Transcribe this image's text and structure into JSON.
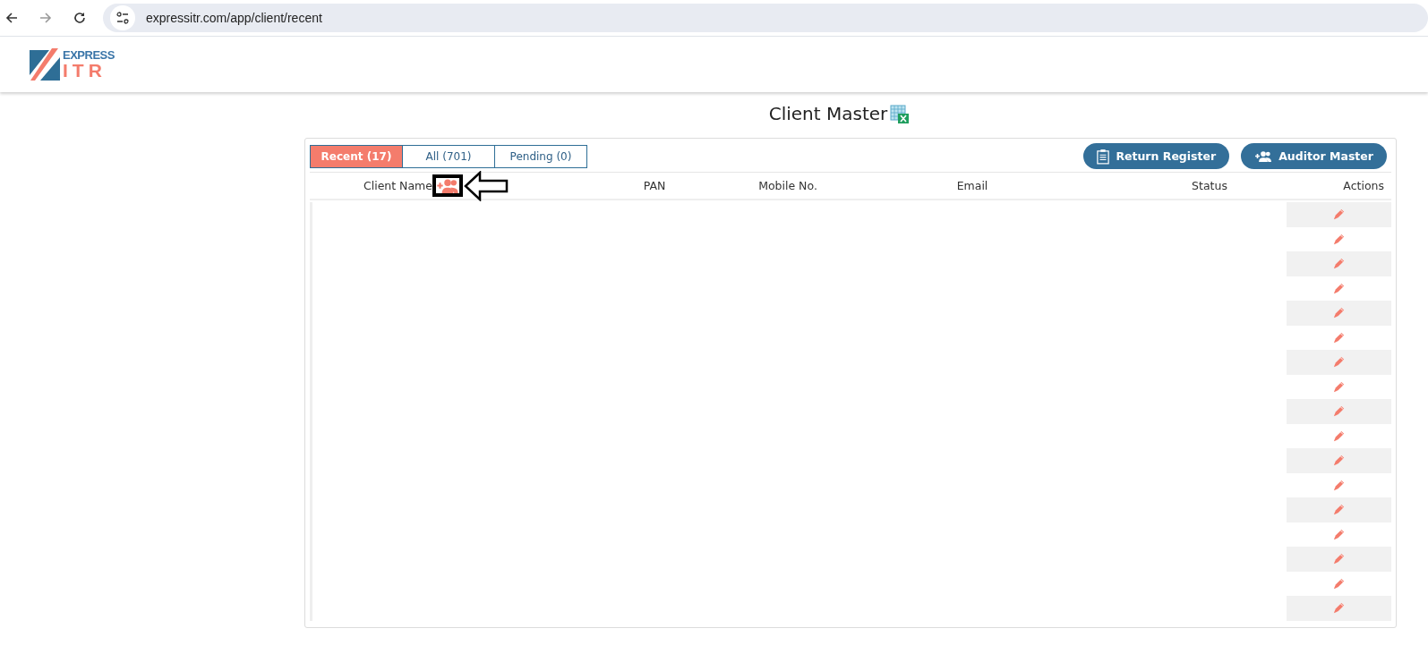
{
  "browser": {
    "url": "expressitr.com/app/client/recent"
  },
  "logo": {
    "line_1": "EXPRESS",
    "line_2": "ITR"
  },
  "page": {
    "title": "Client Master"
  },
  "tabs": [
    {
      "label": "Recent (17)",
      "selected": true
    },
    {
      "label": "All (701)",
      "selected": false
    },
    {
      "label": "Pending (0)",
      "selected": false
    }
  ],
  "buttons": [
    {
      "label": "Return Register",
      "kind": "clipboard"
    },
    {
      "label": "Auditor Master",
      "kind": "add-users"
    }
  ],
  "table": {
    "columns": [
      "Client Name",
      "PAN",
      "Mobile No.",
      "Email",
      "Status",
      "Actions"
    ],
    "rows": [
      {
        "kind": "edit"
      },
      {
        "kind": "edit"
      },
      {
        "kind": "edit"
      },
      {
        "kind": "edit"
      },
      {
        "kind": "edit"
      },
      {
        "kind": "edit"
      },
      {
        "kind": "edit"
      },
      {
        "kind": "edit"
      },
      {
        "kind": "edit"
      },
      {
        "kind": "edit"
      },
      {
        "kind": "edit"
      },
      {
        "kind": "edit"
      },
      {
        "kind": "edit"
      },
      {
        "kind": "edit"
      },
      {
        "kind": "edit"
      },
      {
        "kind": "edit"
      },
      {
        "kind": "edit"
      }
    ]
  }
}
